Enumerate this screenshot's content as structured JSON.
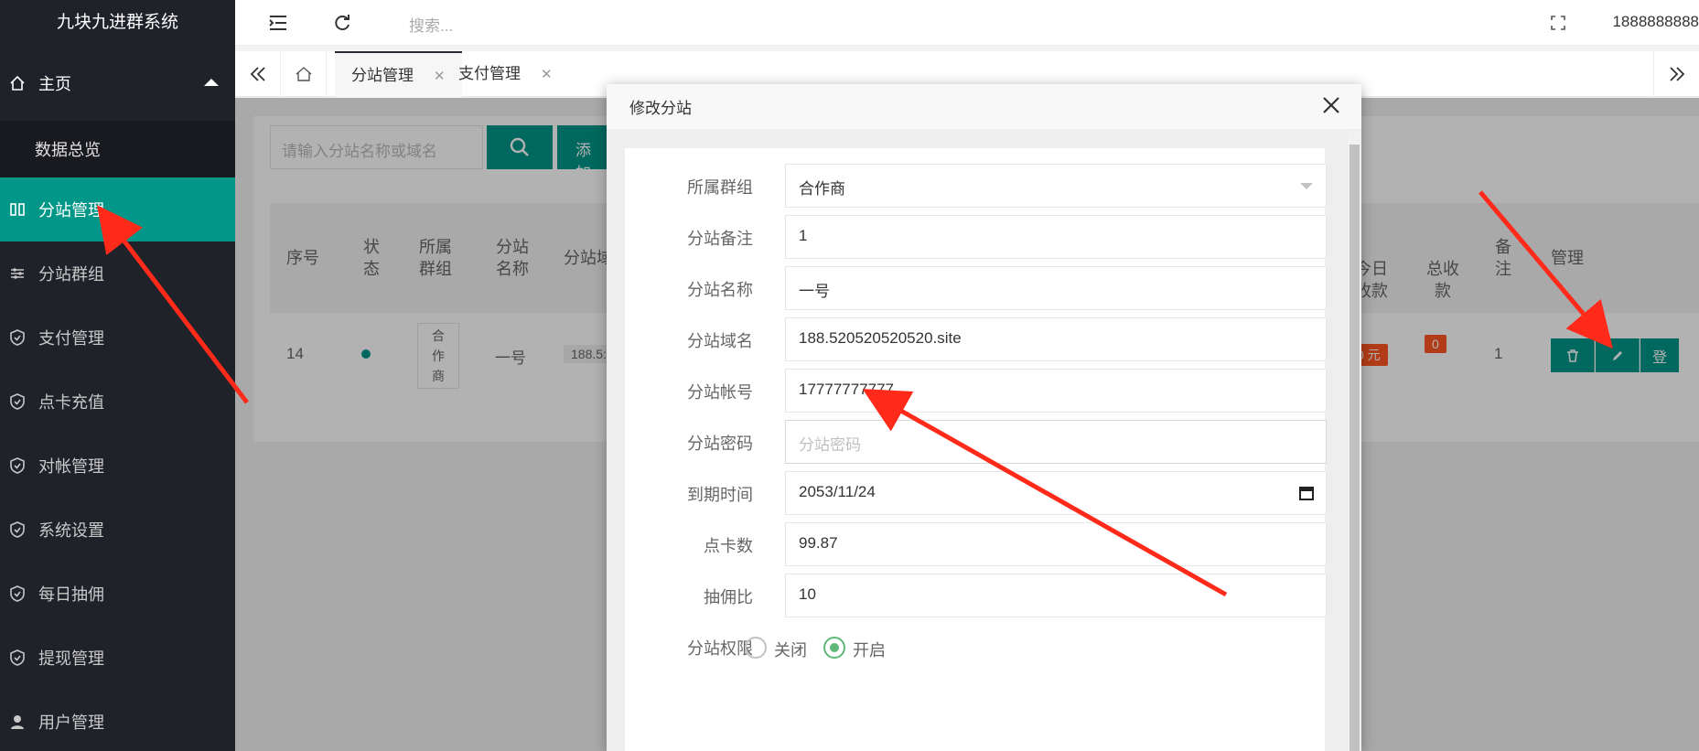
{
  "app": {
    "title": "九块九进群系统"
  },
  "sidebar": {
    "home": "主页",
    "home_sub": "数据总览",
    "items": [
      {
        "label": "分站管理",
        "icon": "columns-icon",
        "active": true
      },
      {
        "label": "分站群组",
        "icon": "sliders-icon"
      },
      {
        "label": "支付管理",
        "icon": "shield-icon"
      },
      {
        "label": "点卡充值",
        "icon": "shield-icon"
      },
      {
        "label": "对帐管理",
        "icon": "shield-icon"
      },
      {
        "label": "系统设置",
        "icon": "shield-icon"
      },
      {
        "label": "每日抽佣",
        "icon": "shield-icon"
      },
      {
        "label": "提现管理",
        "icon": "shield-icon"
      },
      {
        "label": "用户管理",
        "icon": "user-icon"
      }
    ]
  },
  "header": {
    "search_placeholder": "搜索...",
    "user": "1888888888"
  },
  "tabs": [
    {
      "label": "分站管理",
      "active": true
    },
    {
      "label": "支付管理"
    }
  ],
  "toolbar": {
    "search_placeholder": "请输入分站名称或域名",
    "add_label": "添加"
  },
  "table": {
    "headers": {
      "index": "序号",
      "status": "状态",
      "group": "所属群组",
      "name": "分站名称",
      "domain": "分站域",
      "today": "今日收款",
      "total": "总收款",
      "note": "备注",
      "manage": "管理"
    },
    "row": {
      "index": "14",
      "group": "合作商",
      "name": "一号",
      "domain": "188.5:",
      "today": "0 元",
      "total": "0",
      "note": "1",
      "login": "登"
    }
  },
  "modal": {
    "title": "修改分站",
    "fields": [
      {
        "label": "所属群组",
        "value": "合作商",
        "type": "select"
      },
      {
        "label": "分站备注",
        "value": "1"
      },
      {
        "label": "分站名称",
        "value": "一号"
      },
      {
        "label": "分站域名",
        "value": "188.520520520520.site"
      },
      {
        "label": "分站帐号",
        "value": "17777777777"
      },
      {
        "label": "分站密码",
        "value": "",
        "placeholder": "分站密码"
      },
      {
        "label": "到期时间",
        "value": "2053/11/24",
        "type": "date"
      },
      {
        "label": "点卡数",
        "value": "99.87"
      },
      {
        "label": "抽佣比",
        "value": "10"
      }
    ],
    "permission": {
      "label": "分站权限",
      "off": "关闭",
      "on": "开启",
      "selected": "on"
    }
  },
  "colors": {
    "accent": "#009688",
    "sidebar_bg": "#20222a",
    "danger": "#ff5722",
    "annotation": "#ff2a1a"
  }
}
